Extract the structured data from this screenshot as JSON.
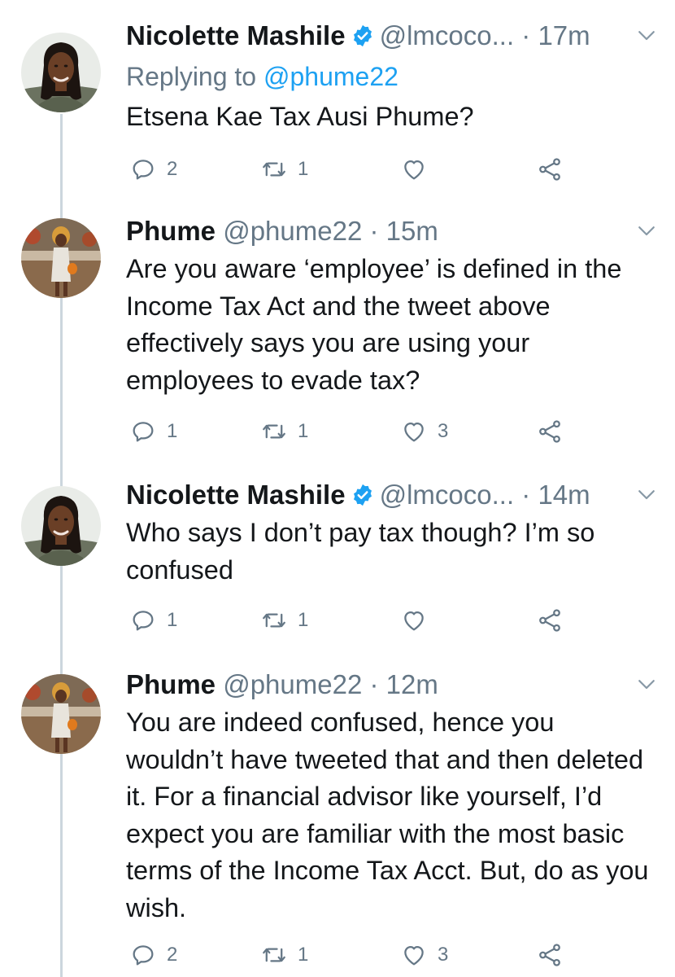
{
  "colors": {
    "accent": "#1da1f2",
    "secondary_text": "#657786",
    "thread_line": "#ccd6dd"
  },
  "tweets": [
    {
      "name": "Nicolette Mashile",
      "verified": true,
      "handle": "@lmcoco...",
      "time": "· 17m",
      "replying_label": "Replying to",
      "replying_to": "@phume22",
      "text": "Etsena Kae Tax Ausi Phume?",
      "replies": "2",
      "retweets": "1",
      "likes": "",
      "icons": [
        "reply-icon",
        "retweet-icon",
        "like-icon",
        "share-icon"
      ]
    },
    {
      "name": "Phume",
      "verified": false,
      "handle": "@phume22",
      "time": "· 15m",
      "text": "Are you aware ‘employee’ is defined in the Income Tax Act and the tweet above effectively says you are using your employees to evade tax?",
      "replies": "1",
      "retweets": "1",
      "likes": "3"
    },
    {
      "name": "Nicolette Mashile",
      "verified": true,
      "handle": "@lmcoco...",
      "time": "· 14m",
      "text": "Who says I don’t pay tax though? I’m so confused",
      "replies": "1",
      "retweets": "1",
      "likes": ""
    },
    {
      "name": "Phume",
      "verified": false,
      "handle": "@phume22",
      "time": "· 12m",
      "text": "You are indeed confused, hence you wouldn’t have tweeted that and then deleted it. For a financial advisor like yourself, I’d expect you are familiar with the most basic terms of the Income Tax Acct. But, do as you wish.",
      "replies": "2",
      "retweets": "1",
      "likes": "3"
    }
  ]
}
